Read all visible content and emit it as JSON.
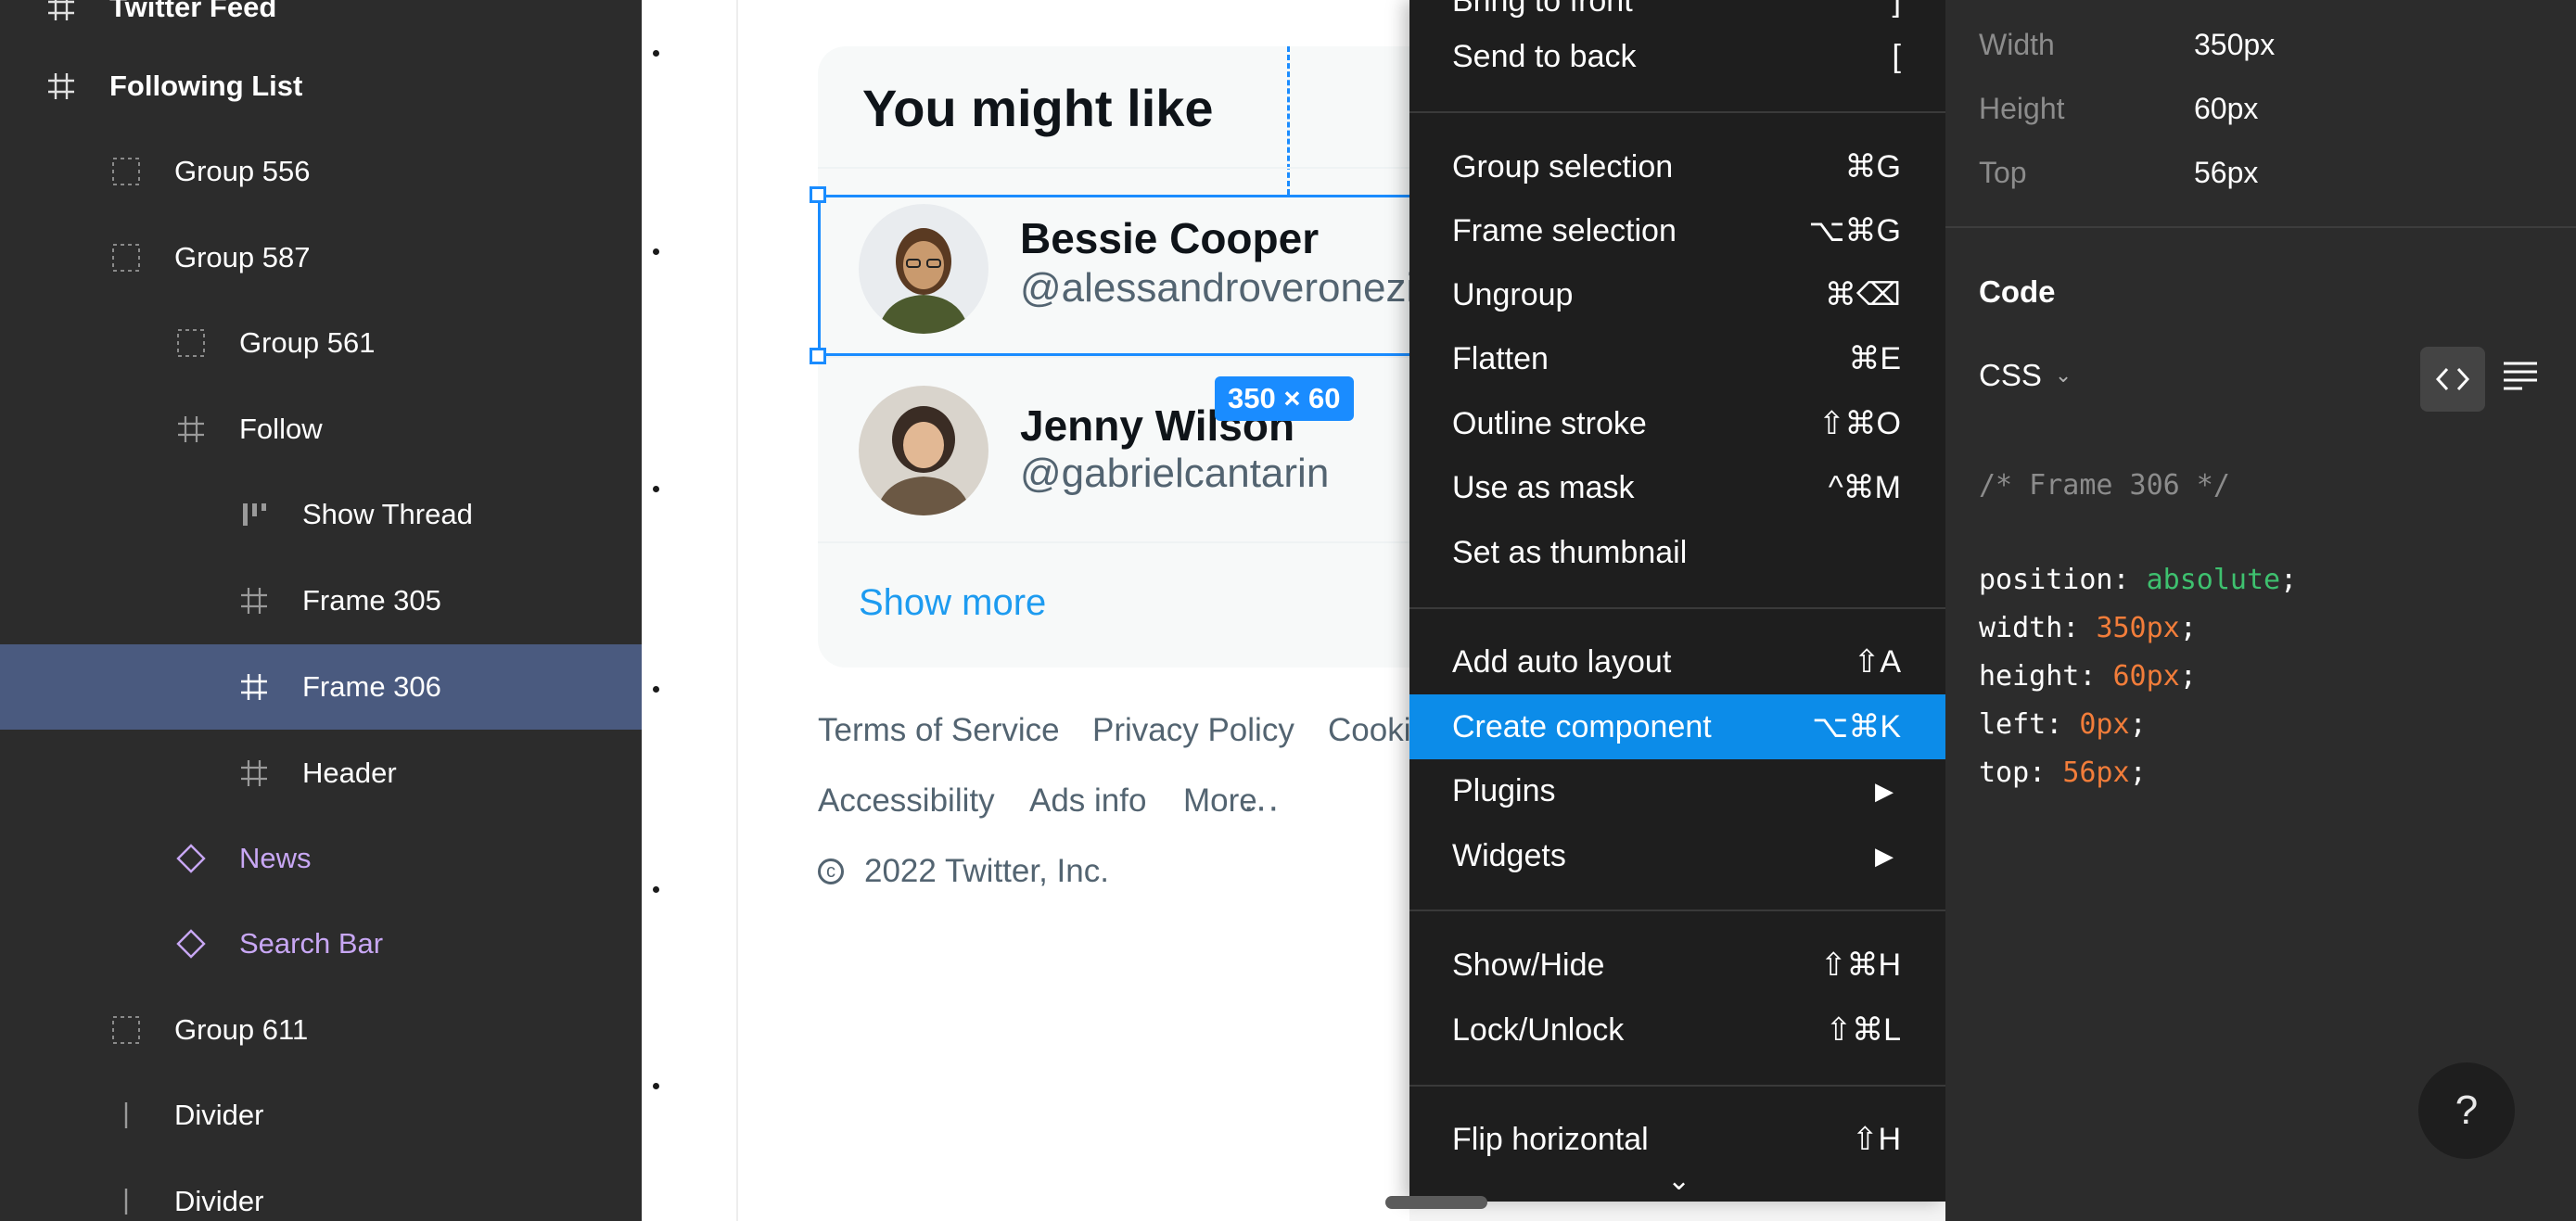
{
  "layers": {
    "items": [
      {
        "label": "Twitter Feed"
      },
      {
        "label": "Following List"
      },
      {
        "label": "Group 556"
      },
      {
        "label": "Group 587"
      },
      {
        "label": "Group 561"
      },
      {
        "label": "Follow"
      },
      {
        "label": "Show Thread"
      },
      {
        "label": "Frame 305"
      },
      {
        "label": "Frame 306"
      },
      {
        "label": "Header"
      },
      {
        "label": "News"
      },
      {
        "label": "Search Bar"
      },
      {
        "label": "Group 611"
      },
      {
        "label": "Divider"
      },
      {
        "label": "Divider"
      }
    ]
  },
  "canvas": {
    "card_title": "You might like",
    "users": [
      {
        "name": "Bessie Cooper",
        "handle": "@alessandroveronezi"
      },
      {
        "name": "Jenny Wilson",
        "handle": "@gabrielcantarin"
      }
    ],
    "show_more": "Show more",
    "size_badge": "350 × 60",
    "footer_links": [
      "Terms of Service",
      "Privacy Policy",
      "Cooki",
      "Accessibility",
      "Ads info",
      "More"
    ],
    "footer_more_dots": "···",
    "copyright": "2022 Twitter, Inc."
  },
  "menu": {
    "items": [
      {
        "label": "Bring to front",
        "shortcut": "]"
      },
      {
        "label": "Send to back",
        "shortcut": "["
      },
      {
        "label": "Group selection",
        "shortcut": "⌘G"
      },
      {
        "label": "Frame selection",
        "shortcut": "⌥⌘G"
      },
      {
        "label": "Ungroup",
        "shortcut": "⌘⌫"
      },
      {
        "label": "Flatten",
        "shortcut": "⌘E"
      },
      {
        "label": "Outline stroke",
        "shortcut": "⇧⌘O"
      },
      {
        "label": "Use as mask",
        "shortcut": "^⌘M"
      },
      {
        "label": "Set as thumbnail",
        "shortcut": ""
      },
      {
        "label": "Add auto layout",
        "shortcut": "⇧A"
      },
      {
        "label": "Create component",
        "shortcut": "⌥⌘K"
      },
      {
        "label": "Plugins",
        "shortcut": "▶"
      },
      {
        "label": "Widgets",
        "shortcut": "▶"
      },
      {
        "label": "Show/Hide",
        "shortcut": "⇧⌘H"
      },
      {
        "label": "Lock/Unlock",
        "shortcut": "⇧⌘L"
      },
      {
        "label": "Flip horizontal",
        "shortcut": "⇧H"
      }
    ],
    "highlighted": "Create component",
    "more_chevron": "⌄"
  },
  "inspector": {
    "props": [
      {
        "label": "Width",
        "value": "350px"
      },
      {
        "label": "Height",
        "value": "60px"
      },
      {
        "label": "Top",
        "value": "56px"
      }
    ],
    "code_title": "Code",
    "language": "CSS",
    "code": {
      "comment": "/* Frame 306 */",
      "lines": [
        {
          "prop": "position: ",
          "value": "absolute",
          "color": "green"
        },
        {
          "prop": "width: ",
          "value": "350px",
          "color": "orange"
        },
        {
          "prop": "height: ",
          "value": "60px",
          "color": "orange"
        },
        {
          "prop": "left: ",
          "value": "0px",
          "color": "orange"
        },
        {
          "prop": "top: ",
          "value": "56px",
          "color": "orange"
        }
      ]
    },
    "help": "?"
  },
  "colors": {
    "panel_bg": "#2c2c2c",
    "menu_bg": "#1e1e1e",
    "selection_blue": "#0c8ce9",
    "layer_selected": "#4a5a7f",
    "component_purple": "#c8a7f4",
    "twitter_blue": "#1d9bf0"
  }
}
